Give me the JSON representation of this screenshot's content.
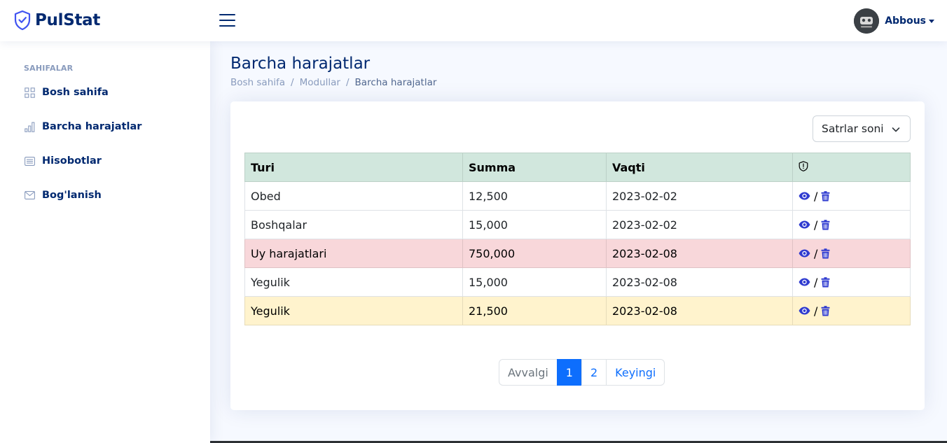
{
  "header": {
    "logo_text": "PulStat",
    "profile_name": "Abbous"
  },
  "sidebar": {
    "heading": "SAHIFALAR",
    "items": [
      {
        "label": "Bosh sahifa",
        "icon": "grid-icon"
      },
      {
        "label": "Barcha harajatlar",
        "icon": "bar-chart-icon"
      },
      {
        "label": "Hisobotlar",
        "icon": "list-card-icon"
      },
      {
        "label": "Bog'lanish",
        "icon": "envelope-icon"
      }
    ]
  },
  "main": {
    "title": "Barcha harajatlar",
    "breadcrumb": [
      "Bosh sahifa",
      "Modullar",
      "Barcha harajatlar"
    ],
    "rows_select": {
      "selected": "Satrlar soni"
    },
    "table": {
      "headers": [
        "Turi",
        "Summa",
        "Vaqti"
      ],
      "actions_header_icon": "shield-exclamation-icon",
      "rows": [
        {
          "turi": "Obed",
          "summa": "12,500",
          "vaqti": "2023-02-02",
          "variant": "default"
        },
        {
          "turi": "Boshqalar",
          "summa": "15,000",
          "vaqti": "2023-02-02",
          "variant": "default"
        },
        {
          "turi": "Uy harajatlari",
          "summa": "750,000",
          "vaqti": "2023-02-08",
          "variant": "danger"
        },
        {
          "turi": "Yegulik",
          "summa": "15,000",
          "vaqti": "2023-02-08",
          "variant": "default"
        },
        {
          "turi": "Yegulik",
          "summa": "21,500",
          "vaqti": "2023-02-08",
          "variant": "warning"
        }
      ],
      "action_separator": "/"
    },
    "pagination": {
      "prev": "Avvalgi",
      "pages": [
        "1",
        "2"
      ],
      "current": "1",
      "next": "Keyingi"
    }
  },
  "colors": {
    "brand": "#012970",
    "primary": "#0d6efd",
    "header_row": "#d1e7dd",
    "danger_row": "#f8d7da",
    "warning_row": "#fff3cd",
    "action_icon": "#2f3bd0"
  }
}
